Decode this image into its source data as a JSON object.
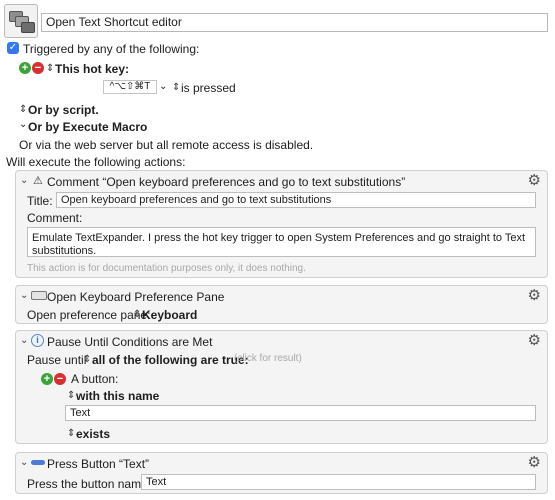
{
  "macro": {
    "name": "Open Text Shortcut editor"
  },
  "triggers": {
    "checkbox_label": "Triggered by any of the following:",
    "hotkey_label": "This hot key:",
    "hotkey_value": "^⌥⇧⌘T",
    "hotkey_condition": "is pressed",
    "or_script": "Or by script.",
    "or_execute_macro": "Or by Execute Macro",
    "or_webserver": "Or via the web server but all remote access is disabled."
  },
  "actions_label": "Will execute the following actions:",
  "actions": {
    "comment": {
      "header": "Comment “Open keyboard preferences and go to text substitutions”",
      "title_label": "Title:",
      "title_value": "Open keyboard preferences and go to text substitutions",
      "comment_label": "Comment:",
      "comment_value": "Emulate TextExpander. I press the hot key trigger to open System Preferences and go straight to Text substitutions.",
      "note": "This action is for documentation purposes only, it does nothing."
    },
    "keyboard_pane": {
      "header": "Open Keyboard Preference Pane",
      "label": "Open preference pane:",
      "value": "Keyboard"
    },
    "pause": {
      "header": "Pause Until Conditions are Met",
      "pause_label": "Pause until",
      "pause_value": "all of the following are true:",
      "click_hint": "(click for result)",
      "condition_label": "A button:",
      "match_mode": "with this name",
      "name_value": "Text",
      "exists": "exists"
    },
    "press_button": {
      "header": "Press Button “Text”",
      "label": "Press the button named:",
      "value": "Text"
    }
  }
}
